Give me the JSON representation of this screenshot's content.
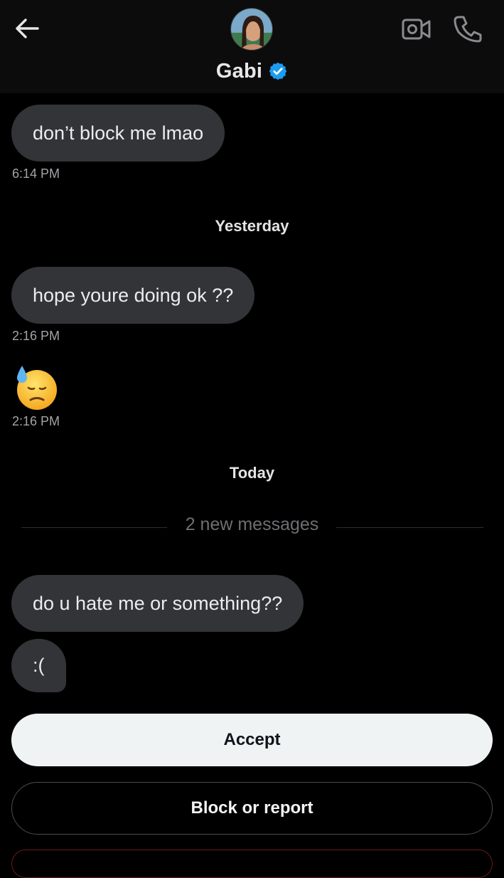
{
  "header": {
    "contact_name": "Gabi",
    "verified": true,
    "accent_color": "#1d9bf0",
    "icons": [
      "back-arrow-icon",
      "avatar",
      "verified-badge-icon",
      "video-call-icon",
      "phone-call-icon"
    ]
  },
  "messages": [
    {
      "text": "don’t block me lmao",
      "time": "6:14 PM"
    },
    {
      "text": "hope youre doing ok ??",
      "time": "2:16 PM"
    },
    {
      "emoji": "downcast-face-with-sweat-icon",
      "time": "2:16 PM"
    },
    {
      "text": "do u hate me or something??"
    },
    {
      "text": ":("
    }
  ],
  "day_labels": {
    "yesterday": "Yesterday",
    "today": "Today"
  },
  "new_messages_label": "2 new messages",
  "actions": {
    "accept": "Accept",
    "block_or_report": "Block or report"
  }
}
